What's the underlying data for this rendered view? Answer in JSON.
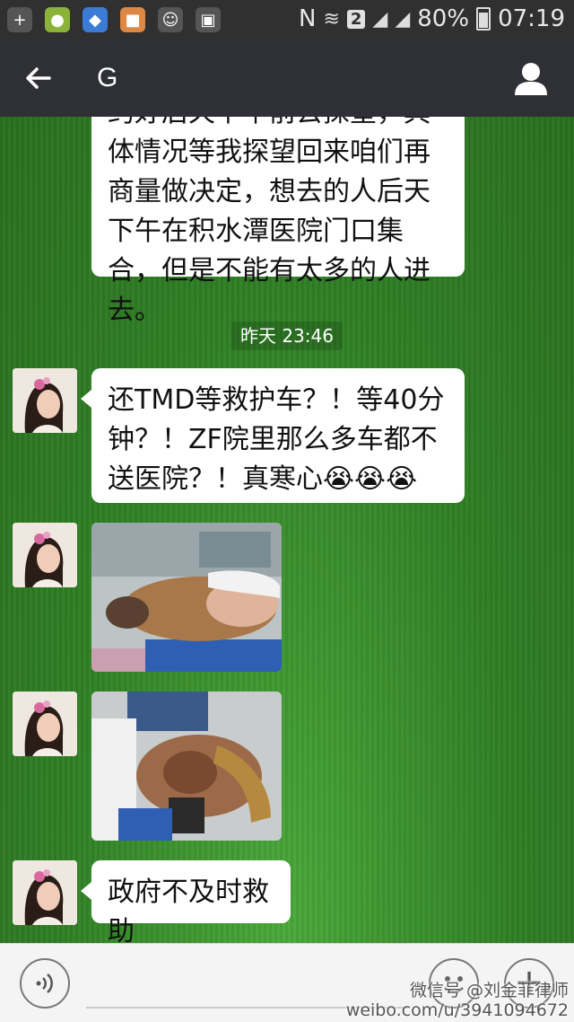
{
  "status_bar": {
    "network": "N",
    "sim_badge": "2",
    "battery": "80%",
    "time": "07:19"
  },
  "header": {
    "back_icon": "arrow-left-icon",
    "title": "G",
    "profile_icon": "person-icon"
  },
  "messages": [
    {
      "type": "text",
      "side": "left",
      "text": "约好后天下午前去探望，具体情况等我探望回来咱们再商量做决定，想去的人后天下午在积水潭医院门口集合，但是不能有太多的人进去。"
    },
    {
      "type": "timestamp",
      "text": "昨天 23:46"
    },
    {
      "type": "text",
      "side": "left",
      "text": "还TMD等救护车？！等40分钟？！ZF院里那么多车都不送医院？！真寒心",
      "emoji": "😭😭😭"
    },
    {
      "type": "image",
      "side": "left",
      "icon": "photo-icon"
    },
    {
      "type": "image",
      "side": "left",
      "icon": "photo-icon"
    },
    {
      "type": "text",
      "side": "left",
      "text": "政府不及时救助"
    }
  ],
  "input_bar": {
    "voice_icon": "voice-icon",
    "emoji_icon": "smiley-icon",
    "plus_icon": "plus-icon"
  },
  "watermark": {
    "line1": "微信号 @刘金菲律师",
    "line2": "weibo.com/u/3941094672"
  },
  "colors": {
    "status_bar": "#303030",
    "title_bar": "#2e3036",
    "bubble": "#ffffff",
    "grass": "#2f7a22"
  }
}
